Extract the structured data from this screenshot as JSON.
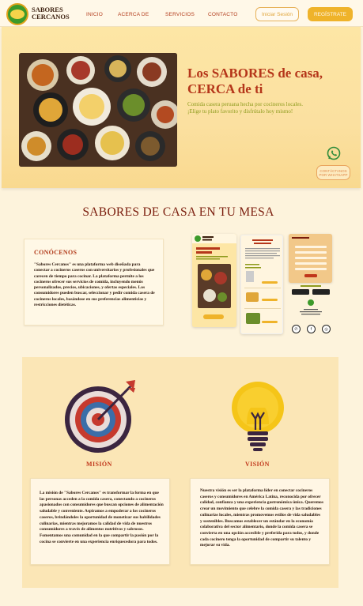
{
  "header": {
    "brand_line1": "SABORES",
    "brand_line2": "CERCANOS",
    "nav": [
      "INICIO",
      "ACERCA DE",
      "SERVICIOS",
      "CONTACTO"
    ],
    "login_label": "Iniciar Sesión",
    "register_label": "REGÍSTRATE"
  },
  "hero": {
    "title_line1": "Los SABORES de casa,",
    "title_line2": "CERCA de ti",
    "subtitle_line1": "Comida casera peruana hecha por cocineros locales.",
    "subtitle_line2": "¡Elige tu plato favorito y disfrútalo hoy mismo!",
    "whatsapp_label_line1": "CONTÁCTANOS",
    "whatsapp_label_line2": "POR WHATSAPP"
  },
  "section2": {
    "title": "SABORES DE CASA EN TU MESA",
    "about_heading": "CONÓCENOS",
    "about_text": "\"Sabores Cercanos\" es una plataforma web diseñada para conectar a cocineros caseros con universitarios y profesionales que carecen de tiempo para cocinar. La plataforma permite a los cocineros ofrecer sus servicios de comida, incluyendo menús personalizados, precios, ubicaciones, y ofertas especiales. Los consumidores pueden buscar, seleccionar y pedir comida casera de cocineros locales, basándose en sus preferencias alimenticias y restricciones dietéticas."
  },
  "mission": {
    "mision_label": "MISIÓN",
    "vision_label": "VISIÓN",
    "mision_text": "La misión de \"Sabores Cercanos\" es transformar la forma en que las personas acceden a la comida casera, conectando a cocineros apasionados con consumidores que buscan opciones de alimentación saludable y conveniente. Aspiramos a empoderar a los cocineros caseros, brindándoles la oportunidad de monetizar sus habilidades culinarias, mientras mejoramos la calidad de vida de nuestros consumidores a través de alimentos nutritivos y sabrosos. Fomentamos una comunidad en la que compartir la pasión por la cocina se convierte en una experiencia enriquecedora para todos.",
    "vision_text": "Nuestra visión es ser la plataforma líder en conectar cocineros caseros y consumidores en América Latina, reconocida por ofrecer calidad, confianza y una experiencia gastronómica única. Queremos crear un movimiento que celebre la comida casera y las tradiciones culinarias locales, mientras promovemos estilos de vida saludables y sostenibles. Buscamos establecer un estándar en la economía colaborativa del sector alimentario, donde la comida casera se convierta en una opción accesible y preferida para todos, y donde cada cocinero tenga la oportunidad de compartir su talento y mejorar su vida."
  },
  "colors": {
    "accent": "#b5361a",
    "brand_orange": "#efb32a",
    "subtitle_green": "#8e9b1d",
    "background": "#fdf3dc"
  }
}
